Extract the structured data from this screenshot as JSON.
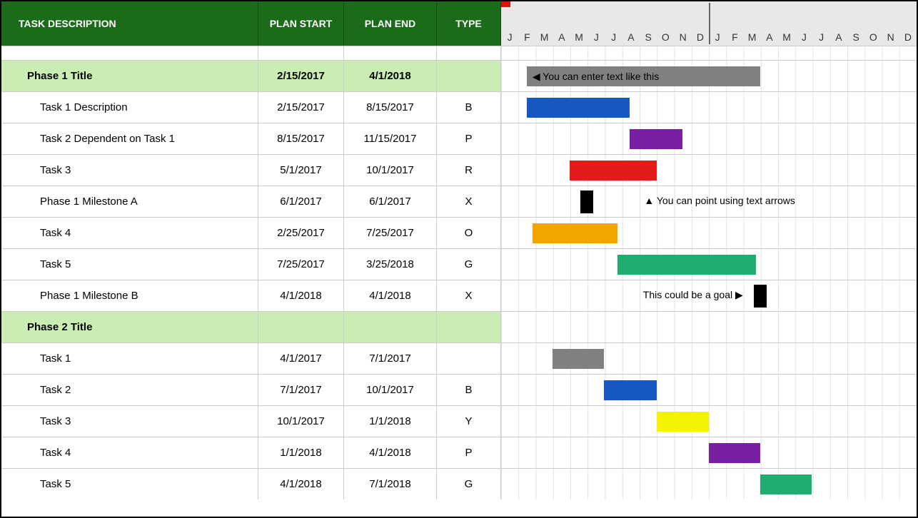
{
  "headers": {
    "task": "TASK DESCRIPTION",
    "start": "PLAN START",
    "end": "PLAN END",
    "type": "TYPE"
  },
  "months": [
    "J",
    "F",
    "M",
    "A",
    "M",
    "J",
    "J",
    "A",
    "S",
    "O",
    "N",
    "D",
    "J",
    "F",
    "M",
    "A",
    "M",
    "J",
    "J",
    "A",
    "S",
    "O",
    "N",
    "D"
  ],
  "annotations": {
    "phase1_bar": "◀ You can enter text like this",
    "milestone_a": "▲ You can point using text arrows",
    "milestone_b": "This could be a goal ▶"
  },
  "rows": [
    {
      "kind": "spacer"
    },
    {
      "kind": "phase",
      "task": "Phase 1 Title",
      "start": "2/15/2017",
      "end": "4/1/2018",
      "type": ""
    },
    {
      "kind": "task",
      "task": "Task 1 Description",
      "start": "2/15/2017",
      "end": "8/15/2017",
      "type": "B"
    },
    {
      "kind": "task",
      "task": "Task 2 Dependent on Task 1",
      "start": "8/15/2017",
      "end": "11/15/2017",
      "type": "P"
    },
    {
      "kind": "task",
      "task": "Task 3",
      "start": "5/1/2017",
      "end": "10/1/2017",
      "type": "R"
    },
    {
      "kind": "task",
      "task": "Phase 1 Milestone A",
      "start": "6/1/2017",
      "end": "6/1/2017",
      "type": "X"
    },
    {
      "kind": "task",
      "task": "Task 4",
      "start": "2/25/2017",
      "end": "7/25/2017",
      "type": "O"
    },
    {
      "kind": "task",
      "task": "Task 5",
      "start": "7/25/2017",
      "end": "3/25/2018",
      "type": "G"
    },
    {
      "kind": "task",
      "task": "Phase 1 Milestone B",
      "start": "4/1/2018",
      "end": "4/1/2018",
      "type": "X"
    },
    {
      "kind": "phase",
      "task": "Phase 2 Title",
      "start": "",
      "end": "",
      "type": ""
    },
    {
      "kind": "task",
      "task": "Task 1",
      "start": "4/1/2017",
      "end": "7/1/2017",
      "type": ""
    },
    {
      "kind": "task",
      "task": "Task 2",
      "start": "7/1/2017",
      "end": "10/1/2017",
      "type": "B"
    },
    {
      "kind": "task",
      "task": "Task 3",
      "start": "10/1/2017",
      "end": "1/1/2018",
      "type": "Y"
    },
    {
      "kind": "task",
      "task": "Task 4",
      "start": "1/1/2018",
      "end": "4/1/2018",
      "type": "P"
    },
    {
      "kind": "task",
      "task": "Task 5",
      "start": "4/1/2018",
      "end": "7/1/2018",
      "type": "G"
    }
  ],
  "chart_data": {
    "type": "gantt",
    "x_range": [
      "2017-01-01",
      "2018-12-31"
    ],
    "xlabel": "",
    "ylabel": "",
    "title": "",
    "colors": {
      "phase": "#808080",
      "default": "#808080",
      "B": "#1558c0",
      "P": "#7b1fa2",
      "R": "#e21b1b",
      "X": "#000000",
      "O": "#f0a500",
      "G": "#1fae6f",
      "Y": "#f4f400"
    },
    "tasks": [
      {
        "group": "Phase 1",
        "name": "Phase 1 Title",
        "start": "2017-02-15",
        "end": "2018-04-01",
        "type": "phase",
        "annotation": "You can enter text like this"
      },
      {
        "group": "Phase 1",
        "name": "Task 1 Description",
        "start": "2017-02-15",
        "end": "2017-08-15",
        "type": "B"
      },
      {
        "group": "Phase 1",
        "name": "Task 2 Dependent on Task 1",
        "start": "2017-08-15",
        "end": "2017-11-15",
        "type": "P"
      },
      {
        "group": "Phase 1",
        "name": "Task 3",
        "start": "2017-05-01",
        "end": "2017-10-01",
        "type": "R"
      },
      {
        "group": "Phase 1",
        "name": "Phase 1 Milestone A",
        "start": "2017-06-01",
        "end": "2017-06-01",
        "type": "X",
        "milestone": true,
        "annotation": "You can point using text arrows"
      },
      {
        "group": "Phase 1",
        "name": "Task 4",
        "start": "2017-02-25",
        "end": "2017-07-25",
        "type": "O"
      },
      {
        "group": "Phase 1",
        "name": "Task 5",
        "start": "2017-07-25",
        "end": "2018-03-25",
        "type": "G"
      },
      {
        "group": "Phase 1",
        "name": "Phase 1 Milestone B",
        "start": "2018-04-01",
        "end": "2018-04-01",
        "type": "X",
        "milestone": true,
        "annotation": "This could be a goal"
      },
      {
        "group": "Phase 2",
        "name": "Phase 2 Title",
        "start": "",
        "end": "",
        "type": "phase"
      },
      {
        "group": "Phase 2",
        "name": "Task 1",
        "start": "2017-04-01",
        "end": "2017-07-01",
        "type": ""
      },
      {
        "group": "Phase 2",
        "name": "Task 2",
        "start": "2017-07-01",
        "end": "2017-10-01",
        "type": "B"
      },
      {
        "group": "Phase 2",
        "name": "Task 3",
        "start": "2017-10-01",
        "end": "2018-01-01",
        "type": "Y"
      },
      {
        "group": "Phase 2",
        "name": "Task 4",
        "start": "2018-01-01",
        "end": "2018-04-01",
        "type": "P"
      },
      {
        "group": "Phase 2",
        "name": "Task 5",
        "start": "2018-04-01",
        "end": "2018-07-01",
        "type": "G"
      }
    ]
  }
}
